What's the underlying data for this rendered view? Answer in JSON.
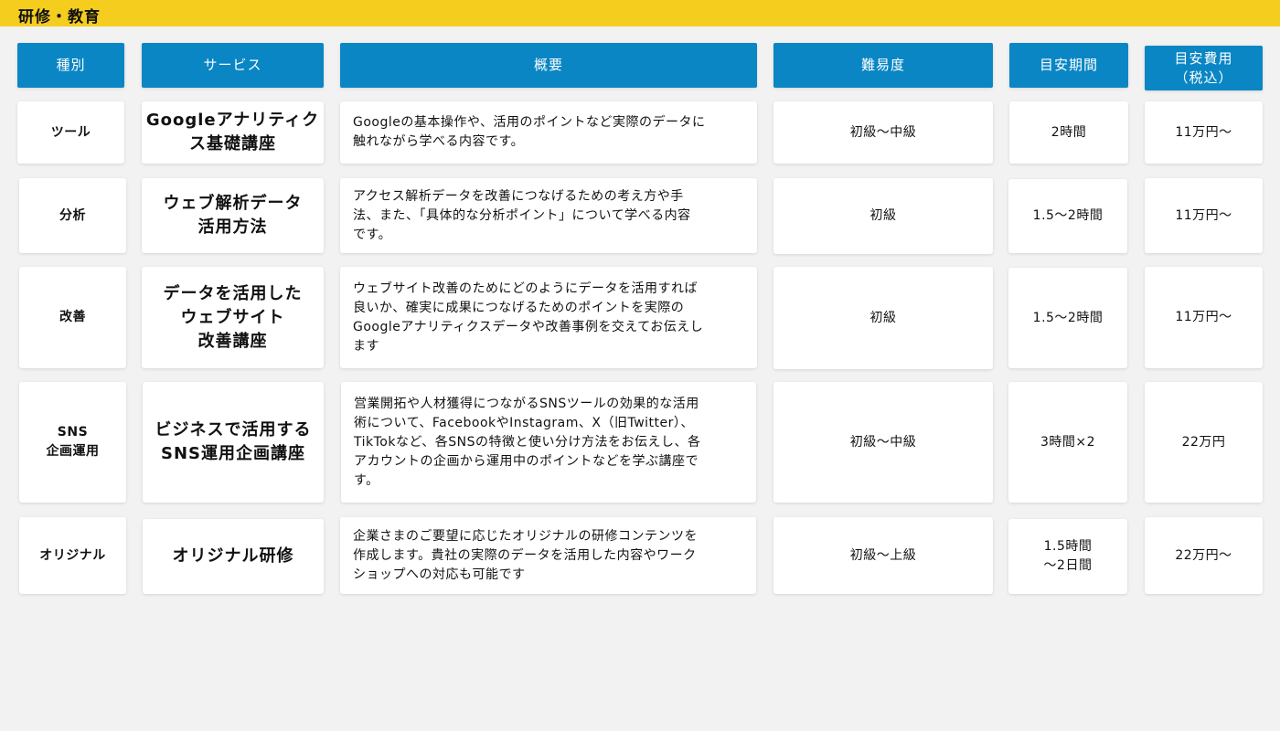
{
  "page": {
    "title": "研修・教育",
    "accent_yellow": "#f5cd1f",
    "header_blue": "#0a86c4",
    "background": "#f2f2f2"
  },
  "table": {
    "headers": [
      "種別",
      "サービス",
      "概要",
      "難易度",
      "目安期間",
      "目安費用\n（税込）"
    ],
    "rows": [
      {
        "type": "ツール",
        "service": "Googleアナリティク\nス基礎講座",
        "description": "Googleの基本操作や、活用のポイントなど実際のデータに\n触れながら学べる内容です。",
        "difficulty": "初級〜中級",
        "duration": "2時間",
        "cost": "11万円〜"
      },
      {
        "type": "分析",
        "service": "ウェブ解析データ\n活用方法",
        "description": "アクセス解析データを改善につなげるための考え方や手\n法、また、「具体的な分析ポイント」について学べる内容\nです。",
        "difficulty": "初級",
        "duration": "1.5〜2時間",
        "cost": "11万円〜"
      },
      {
        "type": "改善",
        "service": "データを活用した\nウェブサイト\n改善講座",
        "description": "ウェブサイト改善のためにどのようにデータを活用すれば\n良いか、確実に成果につなげるためのポイントを実際の\nGoogleアナリティクスデータや改善事例を交えてお伝えし\nます",
        "difficulty": "初級",
        "duration": "1.5〜2時間",
        "cost": "11万円〜"
      },
      {
        "type": "SNS\n企画運用",
        "service": "ビジネスで活用する\nSNS運用企画講座",
        "description": "営業開拓や人材獲得につながるSNSツールの効果的な活用\n術について、FacebookやInstagram、X（旧Twitter）、\nTikTokなど、各SNSの特徴と使い分け方法をお伝えし、各\nアカウントの企画から運用中のポイントなどを学ぶ講座で\nす。",
        "difficulty": "初級〜中級",
        "duration": "3時間×2",
        "cost": "22万円"
      },
      {
        "type": "オリジナル",
        "service": "オリジナル研修",
        "description": "企業さまのご要望に応じたオリジナルの研修コンテンツを\n作成します。貴社の実際のデータを活用した内容やワーク\nショップへの対応も可能です",
        "difficulty": "初級〜上級",
        "duration": "1.5時間\n〜2日間",
        "cost": "22万円〜"
      }
    ]
  }
}
